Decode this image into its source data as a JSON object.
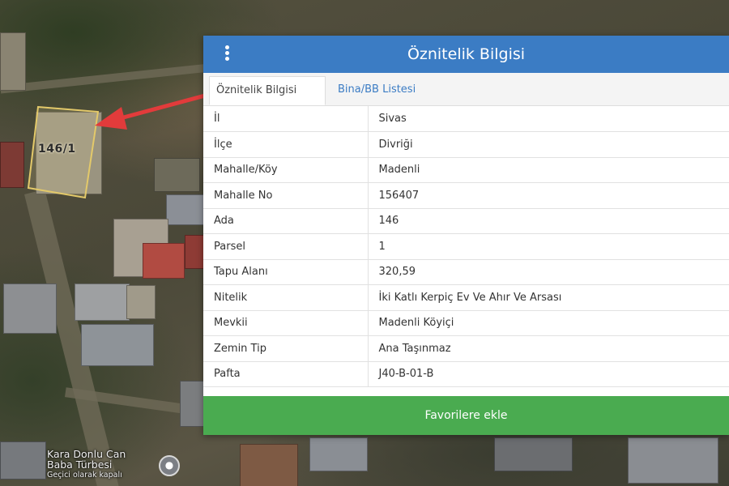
{
  "map": {
    "parcel_label": "146/1",
    "poi_name_line1": "Kara Donlu Can",
    "poi_name_line2": "Baba Türbesi",
    "poi_status": "Geçici olarak kapalı"
  },
  "panel": {
    "title": "Öznitelik Bilgisi",
    "header_color": "#3b7cc4",
    "tabs": [
      {
        "label": "Öznitelik Bilgisi",
        "active": true
      },
      {
        "label": "Bina/BB Listesi",
        "active": false
      }
    ],
    "rows": [
      {
        "key": "İl",
        "value": "Sivas"
      },
      {
        "key": "İlçe",
        "value": "Divriği"
      },
      {
        "key": "Mahalle/Köy",
        "value": "Madenli"
      },
      {
        "key": "Mahalle No",
        "value": "156407"
      },
      {
        "key": "Ada",
        "value": "146"
      },
      {
        "key": "Parsel",
        "value": "1"
      },
      {
        "key": "Tapu Alanı",
        "value": "320,59"
      },
      {
        "key": "Nitelik",
        "value": "İki Katlı Kerpiç Ev Ve Ahır Ve Arsası"
      },
      {
        "key": "Mevkii",
        "value": "Madenli Köyiçi"
      },
      {
        "key": "Zemin Tip",
        "value": "Ana Taşınmaz"
      },
      {
        "key": "Pafta",
        "value": "J40-B-01-B"
      }
    ],
    "favorite_button": "Favorilere ekle",
    "favorite_color": "#4aab50"
  },
  "annotation": {
    "arrow_color": "#e23b3b"
  }
}
